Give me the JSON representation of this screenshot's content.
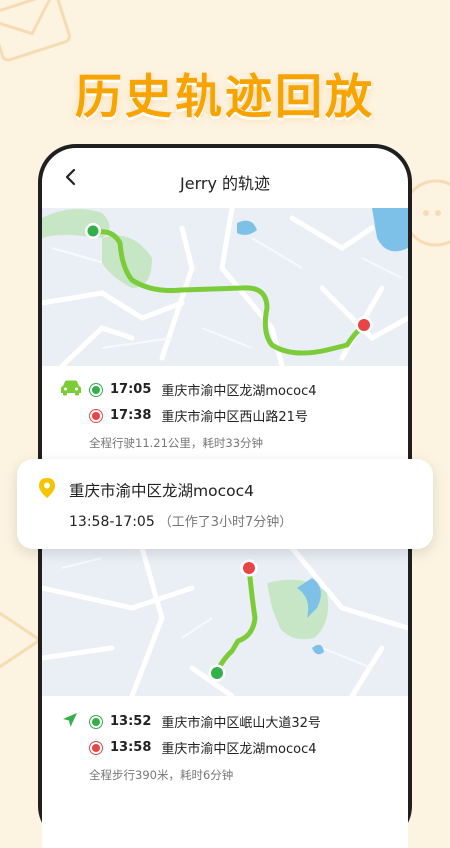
{
  "headline": "历史轨迹回放",
  "nav": {
    "title": "Jerry 的轨迹"
  },
  "trip1": {
    "mode_icon": "car-icon",
    "start": {
      "time": "17:05",
      "place": "重庆市渝中区龙湖mococ4"
    },
    "end": {
      "time": "17:38",
      "place": "重庆市渝中区西山路21号"
    },
    "summary": "全程行驶11.21公里，耗时33分钟"
  },
  "stop": {
    "icon": "location-pin-icon",
    "place": "重庆市渝中区龙湖mococ4",
    "time_range": "13:58-17:05",
    "duration_note": "（工作了3小时7分钟）"
  },
  "trip2": {
    "mode_icon": "navigation-arrow-icon",
    "start": {
      "time": "13:52",
      "place": "重庆市渝中区岷山大道32号"
    },
    "end": {
      "time": "13:58",
      "place": "重庆市渝中区龙湖mococ4"
    },
    "summary": "全程步行390米，耗时6分钟"
  },
  "colors": {
    "brand": "#f7a300",
    "route": "#7ccc3a",
    "start_dot": "#34b04a",
    "end_dot": "#e84545",
    "map_bg": "#e9eff5"
  }
}
